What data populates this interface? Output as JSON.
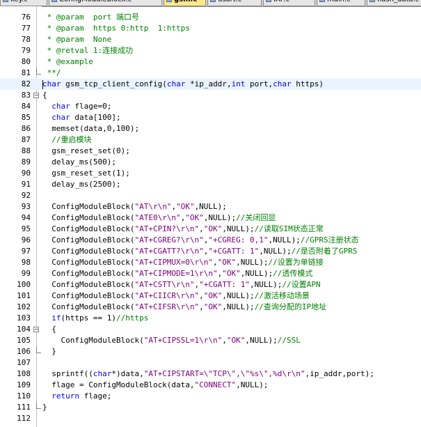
{
  "tabs": [
    {
      "label": "key.c",
      "active": false
    },
    {
      "label": "ConfigModuleBlock.c",
      "active": false
    },
    {
      "label": "gsm.c",
      "active": true
    },
    {
      "label": "usart.c",
      "active": false
    },
    {
      "label": "IAP.c",
      "active": false
    },
    {
      "label": "main.c",
      "active": false
    },
    {
      "label": "flash_data.c",
      "active": false
    }
  ],
  "editor": {
    "current_line": 82,
    "colors": {
      "comment": "#008000",
      "keyword": "#0000ff",
      "string": "#800080",
      "number": "#000000"
    },
    "lines": [
      {
        "n": "76",
        "text": " * @param  port 端口号",
        "fold": ""
      },
      {
        "n": "77",
        "text": " * @param  https 0:http  1:https",
        "fold": ""
      },
      {
        "n": "78",
        "text": " * @param  None",
        "fold": ""
      },
      {
        "n": "79",
        "text": " * @retval 1:连接成功",
        "fold": ""
      },
      {
        "n": "80",
        "text": " * @example",
        "fold": ""
      },
      {
        "n": "81",
        "text": " **/",
        "fold": "end"
      },
      {
        "n": "82",
        "text": "char gsm_tcp_client_config(char *ip_addr,int port,char https)",
        "fold": ""
      },
      {
        "n": "83",
        "text": "{",
        "fold": "box"
      },
      {
        "n": "84",
        "text": "  char flage=0;",
        "fold": ""
      },
      {
        "n": "85",
        "text": "  char data[100];",
        "fold": ""
      },
      {
        "n": "86",
        "text": "  memset(data,0,100);",
        "fold": ""
      },
      {
        "n": "87",
        "text": "  //重启模块",
        "fold": ""
      },
      {
        "n": "88",
        "text": "  gsm_reset_set(0);",
        "fold": ""
      },
      {
        "n": "89",
        "text": "  delay_ms(500);",
        "fold": ""
      },
      {
        "n": "90",
        "text": "  gsm_reset_set(1);",
        "fold": ""
      },
      {
        "n": "91",
        "text": "  delay_ms(2500);",
        "fold": ""
      },
      {
        "n": "92",
        "text": "",
        "fold": ""
      },
      {
        "n": "93",
        "text": "  ConfigModuleBlock(\"AT\\r\\n\",\"OK\",NULL);",
        "fold": ""
      },
      {
        "n": "94",
        "text": "  ConfigModuleBlock(\"ATE0\\r\\n\",\"OK\",NULL);//关闭回显",
        "fold": ""
      },
      {
        "n": "95",
        "text": "  ConfigModuleBlock(\"AT+CPIN?\\r\\n\",\"OK\",NULL);//读取SIM状态正常",
        "fold": ""
      },
      {
        "n": "96",
        "text": "  ConfigModuleBlock(\"AT+CGREG?\\r\\n\",\"+CGREG: 0,1\",NULL);//GPRS注册状态",
        "fold": ""
      },
      {
        "n": "97",
        "text": "  ConfigModuleBlock(\"AT+CGATT?\\r\\n\",\"+CGATT: 1\",NULL);//是否附着了GPRS",
        "fold": ""
      },
      {
        "n": "98",
        "text": "  ConfigModuleBlock(\"AT+CIPMUX=0\\r\\n\",\"OK\",NULL);//设置为单链接",
        "fold": ""
      },
      {
        "n": "99",
        "text": "  ConfigModuleBlock(\"AT+CIPMODE=1\\r\\n\",\"OK\",NULL);//透传模式",
        "fold": ""
      },
      {
        "n": "100",
        "text": "  ConfigModuleBlock(\"AT+CSTT\\r\\n\",\"+CGATT: 1\",NULL);//设置APN",
        "fold": ""
      },
      {
        "n": "101",
        "text": "  ConfigModuleBlock(\"AT+CIICR\\r\\n\",\"OK\",NULL);//激活移动场景",
        "fold": ""
      },
      {
        "n": "102",
        "text": "  ConfigModuleBlock(\"AT+CIFSR\\r\\n\",\"OK\",NULL);//查询分配的IP地址",
        "fold": ""
      },
      {
        "n": "103",
        "text": "  if(https == 1)//https",
        "fold": ""
      },
      {
        "n": "104",
        "text": "  {",
        "fold": "box"
      },
      {
        "n": "105",
        "text": "    ConfigModuleBlock(\"AT+CIPSSL=1\\r\\n\",\"OK\",NULL);//SSL",
        "fold": ""
      },
      {
        "n": "106",
        "text": "  }",
        "fold": "end"
      },
      {
        "n": "107",
        "text": "",
        "fold": ""
      },
      {
        "n": "108",
        "text": "  sprintf((char*)data,\"AT+CIPSTART=\\\"TCP\\\",\\\"%s\\\",%d\\r\\n\",ip_addr,port);",
        "fold": ""
      },
      {
        "n": "109",
        "text": "  flage = ConfigModuleBlock(data,\"CONNECT\",NULL);",
        "fold": ""
      },
      {
        "n": "110",
        "text": "  return flage;",
        "fold": ""
      },
      {
        "n": "111",
        "text": "}",
        "fold": "end"
      },
      {
        "n": "112",
        "text": "",
        "fold": ""
      }
    ]
  }
}
